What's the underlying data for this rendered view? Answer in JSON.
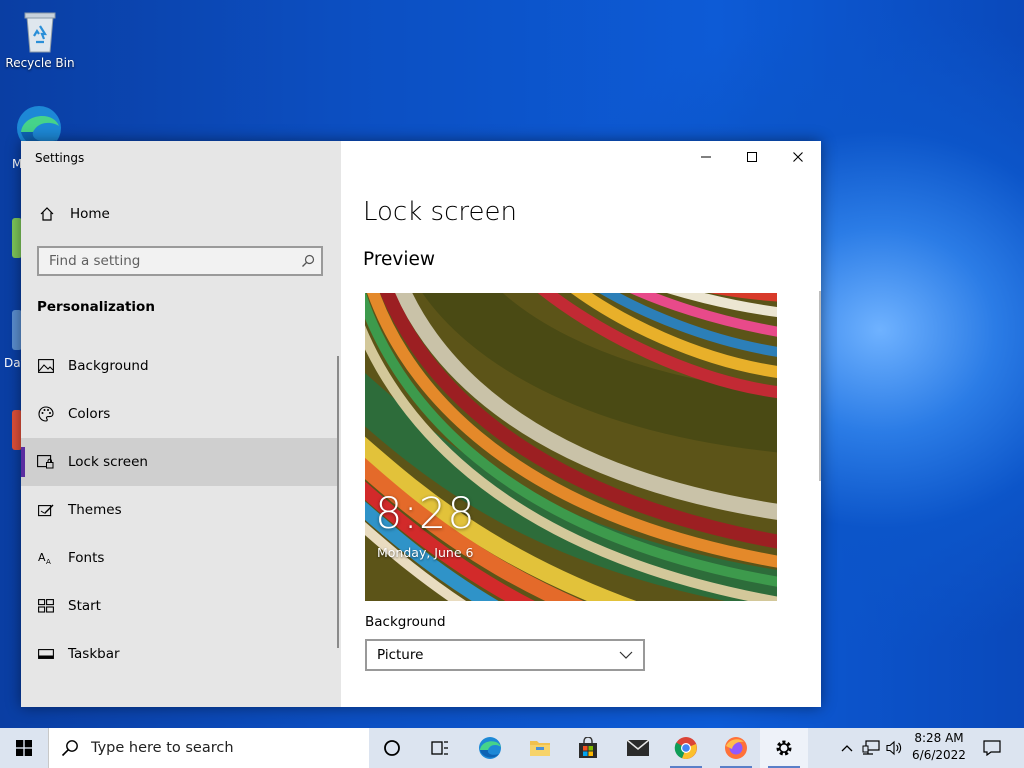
{
  "desktop": {
    "icons": [
      {
        "label": "Recycle Bin"
      }
    ],
    "partial_labels": [
      "M",
      "Dat"
    ]
  },
  "settings": {
    "app_title": "Settings",
    "home_label": "Home",
    "search": {
      "placeholder": "Find a setting"
    },
    "section_title": "Personalization",
    "nav_items": [
      {
        "label": "Background"
      },
      {
        "label": "Colors"
      },
      {
        "label": "Lock screen"
      },
      {
        "label": "Themes"
      },
      {
        "label": "Fonts"
      },
      {
        "label": "Start"
      },
      {
        "label": "Taskbar"
      }
    ],
    "selected_nav": "Lock screen",
    "page_title": "Lock screen",
    "preview_heading": "Preview",
    "lock_preview": {
      "time": "8:28",
      "date": "Monday, June 6"
    },
    "background": {
      "label": "Background",
      "selected": "Picture"
    }
  },
  "taskbar": {
    "search_placeholder": "Type here to search",
    "clock": {
      "time": "8:28 AM",
      "date": "6/6/2022"
    }
  },
  "colors": {
    "accent": "#5a2da0",
    "desktop": "#0c55c9",
    "taskbar": "#dce4f0"
  }
}
